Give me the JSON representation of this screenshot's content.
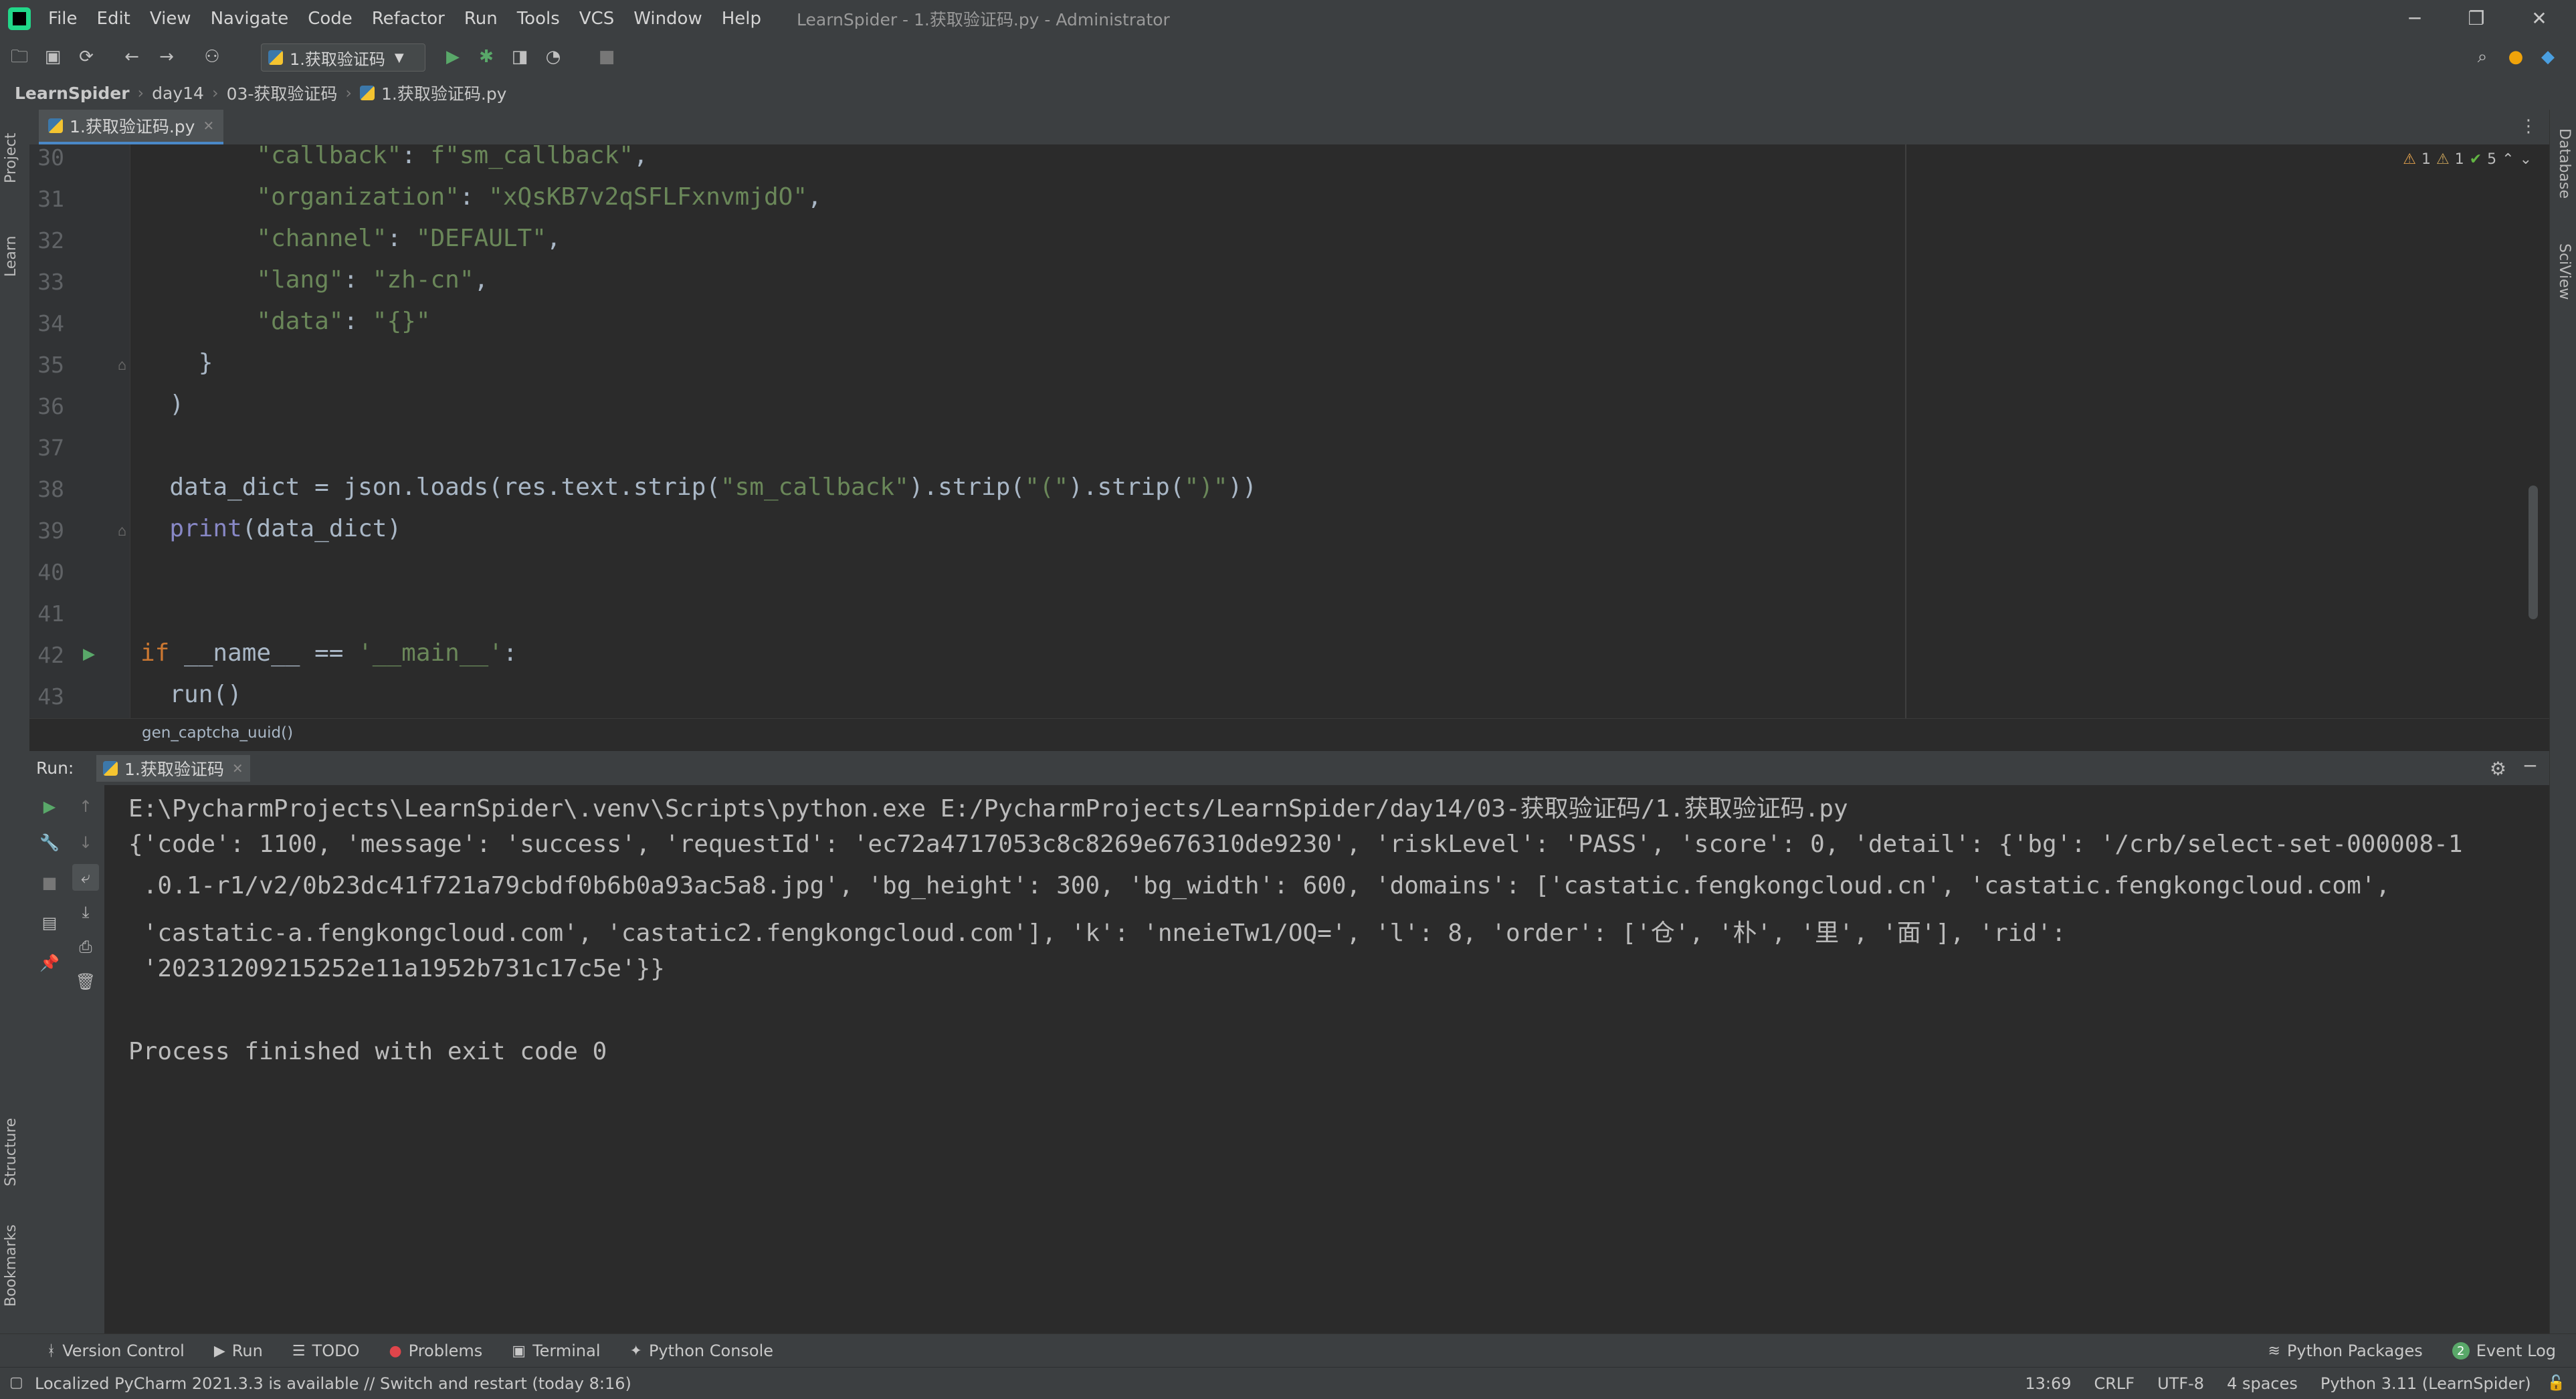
{
  "menubar": {
    "items": [
      "File",
      "Edit",
      "View",
      "Navigate",
      "Code",
      "Refactor",
      "Run",
      "Tools",
      "VCS",
      "Window",
      "Help"
    ],
    "title": "LearnSpider - 1.获取验证码.py - Administrator"
  },
  "toolbar": {
    "run_config": "1.获取验证码"
  },
  "breadcrumb": [
    "LearnSpider",
    "day14",
    "03-获取验证码",
    "1.获取验证码.py"
  ],
  "left_strip": {
    "project": "Project",
    "learn": "Learn",
    "structure": "Structure",
    "bookmarks": "Bookmarks"
  },
  "right_strip": {
    "database": "Database",
    "sciview": "SciView"
  },
  "editor": {
    "tab_label": "1.获取验证码.py",
    "inspections": {
      "warnings_a": "1",
      "warnings_b": "1",
      "ok": "5"
    },
    "line_numbers": [
      "30",
      "31",
      "32",
      "33",
      "34",
      "35",
      "36",
      "37",
      "38",
      "39",
      "40",
      "41",
      "42",
      "43"
    ],
    "context": "gen_captcha_uuid()"
  },
  "run": {
    "label": "Run:",
    "tab_label": "1.获取验证码",
    "console": [
      "E:\\PycharmProjects\\LearnSpider\\.venv\\Scripts\\python.exe E:/PycharmProjects/LearnSpider/day14/03-获取验证码/1.获取验证码.py",
      "{'code': 1100, 'message': 'success', 'requestId': 'ec72a4717053c8c8269e676310de9230', 'riskLevel': 'PASS', 'score': 0, 'detail': {'bg': '/crb/select-set-000008-1",
      " .0.1-r1/v2/0b23dc41f721a79cbdf0b6b0a93ac5a8.jpg', 'bg_height': 300, 'bg_width': 600, 'domains': ['castatic.fengkongcloud.cn', 'castatic.fengkongcloud.com',",
      " 'castatic-a.fengkongcloud.com', 'castatic2.fengkongcloud.com'], 'k': 'nneieTw1/OQ=', 'l': 8, 'order': ['仓', '朴', '里', '面'], 'rid':",
      " '20231209215252e11a1952b731c17c5e'}}",
      "",
      "Process finished with exit code 0"
    ]
  },
  "toolwindows": {
    "version_control": "Version Control",
    "run": "Run",
    "todo": "TODO",
    "problems": "Problems",
    "terminal": "Terminal",
    "python_console": "Python Console",
    "python_packages": "Python Packages",
    "event_log_count": "2",
    "event_log": "Event Log"
  },
  "status": {
    "message": "Localized PyCharm 2021.3.3 is available // Switch and restart (today 8:16)",
    "position": "13:69",
    "line_sep": "CRLF",
    "encoding": "UTF-8",
    "indent": "4 spaces",
    "interpreter": "Python 3.11 (LearnSpider)"
  }
}
